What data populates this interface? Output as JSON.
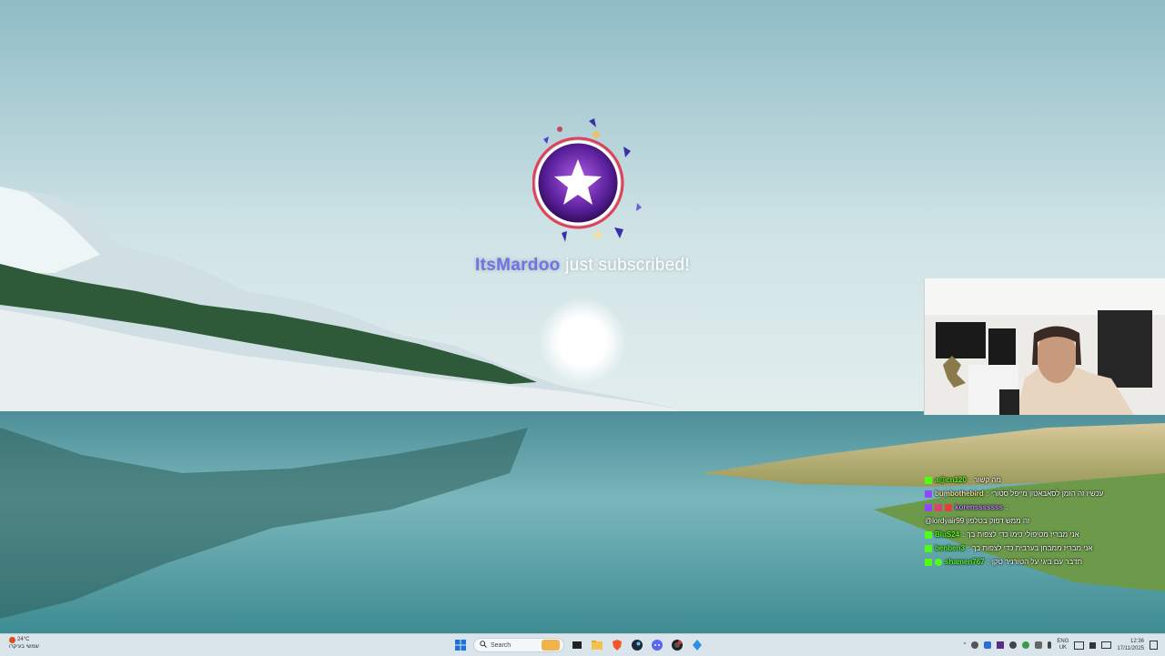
{
  "alert": {
    "username": "ItsMardoo",
    "message": "just subscribed!"
  },
  "chat": [
    {
      "platform": "kick",
      "user": "a@cn120",
      "text": "מה קשור"
    },
    {
      "platform": "twitch",
      "user": "bumbothebird",
      "text": "עכשיו זה הזמן לסאבאטון מייפל סטורי"
    },
    {
      "platform": "twitch",
      "user": "korensssssss",
      "text": ""
    },
    {
      "platform": "none",
      "user": "",
      "text": "@lordyair99 זה ממש דפוק בטלפון"
    },
    {
      "platform": "kick",
      "user": "BluS24",
      "text": "אני מבריז מטיפולי כימו כדי לצפות בך"
    },
    {
      "platform": "kick",
      "user": "benben3",
      "text": "אני מבריז ממבחן בערבית כדי לצפות בך"
    },
    {
      "platform": "kick",
      "user": "shamen767",
      "text": "תדבר עם ביגי על הטורניר טקן"
    }
  ],
  "taskbar": {
    "weather_temp": "24°C",
    "weather_desc": "שמשי בעיקרו",
    "search_placeholder": "Search",
    "lang_top": "ENG",
    "lang_bottom": "UK",
    "time": "12:36",
    "date": "17/11/2025"
  },
  "colors": {
    "alert_username": "#6f73e6",
    "kick_badge": "#53fc18",
    "twitch_badge": "#9146ff"
  },
  "icons": [
    "windows-start-icon",
    "search-icon",
    "file-explorer-icon",
    "folder-icon",
    "brave-icon",
    "steam-icon",
    "discord-icon",
    "obs-icon",
    "app-icon",
    "chevron-up-icon",
    "wifi-icon",
    "volume-icon",
    "battery-icon",
    "notification-icon"
  ]
}
